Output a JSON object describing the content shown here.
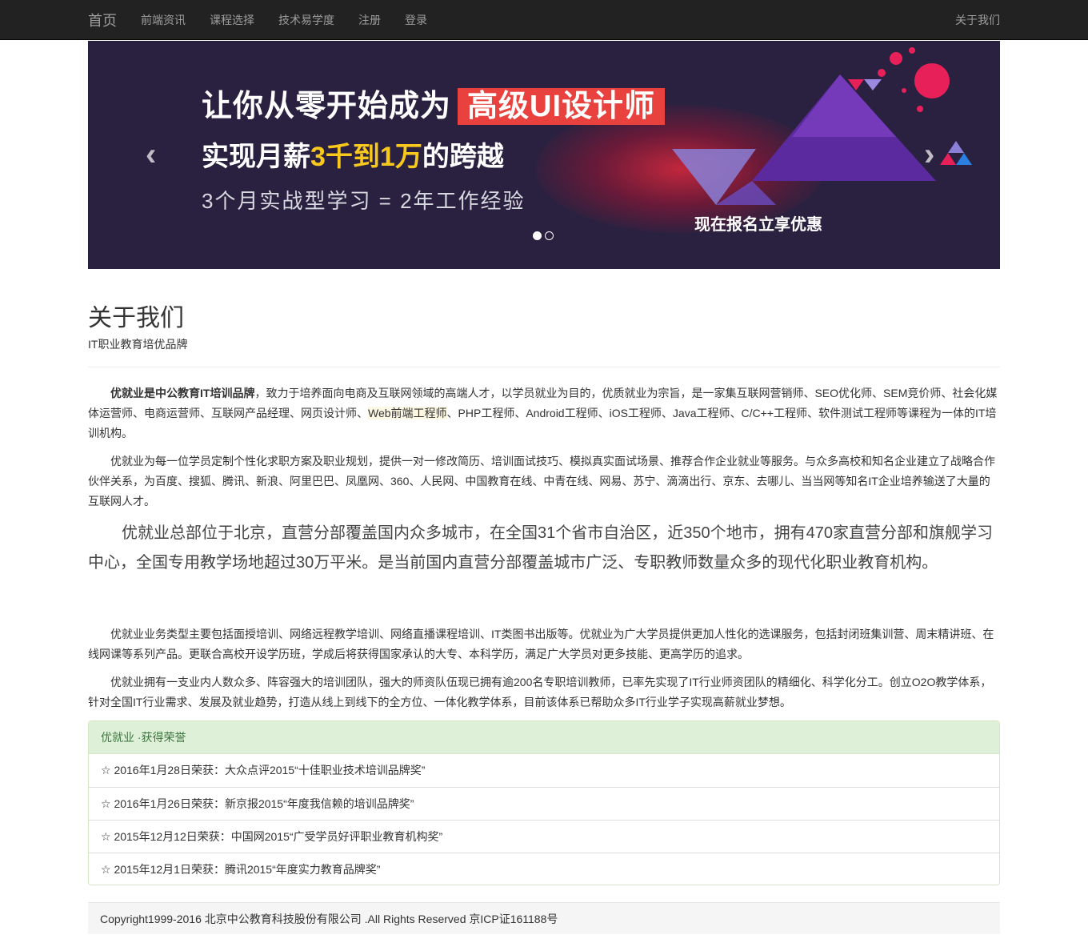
{
  "nav": {
    "brand": "首页",
    "links": [
      "前端资讯",
      "课程选择",
      "技术易学度",
      "注册",
      "登录"
    ],
    "right": "关于我们"
  },
  "carousel": {
    "line1_prefix": "让你从零开始成为",
    "line1_highlight": "高级UI设计师",
    "line2_a": "实现月薪",
    "line2_b": "3千到1万",
    "line2_c": "的跨越",
    "line3": "3个月实战型学习 = 2年工作经验",
    "cta": "现在报名立享优惠",
    "prev_icon": "chevron-left-icon",
    "next_icon": "chevron-right-icon",
    "slide_count": 2,
    "active_slide": 1,
    "colors": {
      "background": "#2a2140",
      "highlight": "#e8413e",
      "yellow": "#f8c81c"
    }
  },
  "about": {
    "title": "关于我们",
    "subtitle": "IT职业教育培优品牌",
    "p1_bold": "优就业是中公教育IT培训品牌",
    "p1_a": "，致力于培养面向电商及互联网领域的高端人才，以学员就业为目的，优质就业为宗旨，是一家集互联网营销师、SEO优化师、SEM竞价师、社会化媒体运营师、电商运营师、互联网产品经理、网页设计师、",
    "p1_mark": "Web前端工程师",
    "p1_b": "、PHP工程师、Android工程师、iOS工程师、Java工程师、C/C++工程师、软件测试工程师等课程为一体的IT培训机构。",
    "p2": "优就业为每一位学员定制个性化求职方案及职业规划，提供一对一修改简历、培训面试技巧、模拟真实面试场景、推荐合作企业就业等服务。与众多高校和知名企业建立了战略合作伙伴关系，为百度、搜狐、腾讯、新浪、阿里巴巴、凤凰网、360、人民网、中国教育在线、中青在线、网易、苏宁、滴滴出行、京东、去哪儿、当当网等知名IT企业培养输送了大量的互联网人才。",
    "p3": "优就业总部位于北京，直营分部覆盖国内众多城市，在全国31个省市自治区，近350个地市，拥有470家直营分部和旗舰学习中心，全国专用教学场地超过30万平米。是当前国内直营分部覆盖城市广泛、专职教师数量众多的现代化职业教育机构。",
    "p4": "优就业业务类型主要包括面授培训、网络远程教学培训、网络直播课程培训、IT类图书出版等。优就业为广大学员提供更加人性化的选课服务，包括封闭班集训营、周末精讲班、在线网课等系列产品。更联合高校开设学历班，学成后将获得国家承认的大专、本科学历，满足广大学员对更多技能、更高学历的追求。",
    "p5": "优就业拥有一支业内人数众多、阵容强大的培训团队，强大的师资队伍现已拥有逾200名专职培训教师，已率先实现了IT行业师资团队的精细化、科学化分工。创立O2O教学体系，针对全国IT行业需求、发展及就业趋势，打造从线上到线下的全方位、一体化教学体系，目前该体系已帮助众多IT行业学子实现高薪就业梦想。"
  },
  "honors": {
    "heading": "优就业 ·获得荣誉",
    "items": [
      "☆ 2016年1月28日荣获：大众点评2015“十佳职业技术培训品牌奖”",
      "☆ 2016年1月26日荣获：新京报2015“年度我信赖的培训品牌奖”",
      "☆ 2015年12月12日荣获：中国网2015“广受学员好评职业教育机构奖”",
      "☆ 2015年12月1日荣获：腾讯2015“年度实力教育品牌奖”"
    ]
  },
  "footer": {
    "text": "Copyright1999-2016 北京中公教育科技股份有限公司 .All Rights Reserved 京ICP证161188号"
  }
}
